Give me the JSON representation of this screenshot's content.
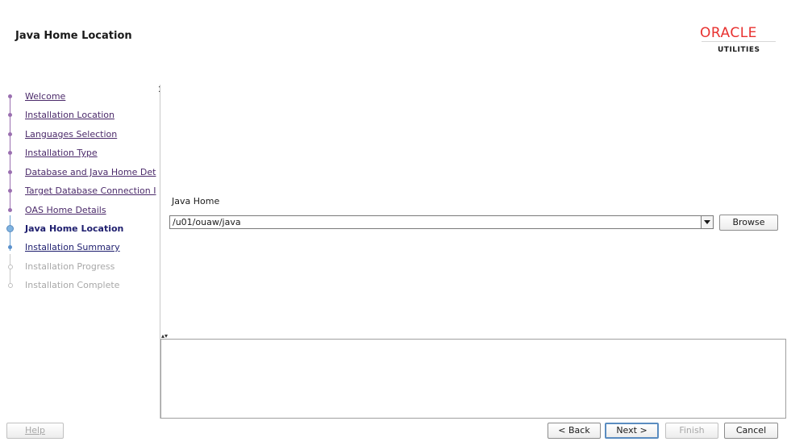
{
  "header": {
    "title": "Java Home Location",
    "logo_brand": "ORACLE",
    "logo_sub": "UTILITIES"
  },
  "steps": [
    {
      "label": "Welcome",
      "state": "done"
    },
    {
      "label": "Installation Location",
      "state": "done"
    },
    {
      "label": "Languages Selection",
      "state": "done"
    },
    {
      "label": "Installation Type",
      "state": "done"
    },
    {
      "label": "Database and Java Home Det",
      "state": "done"
    },
    {
      "label": "Target Database Connection I",
      "state": "done"
    },
    {
      "label": "OAS Home Details",
      "state": "done"
    },
    {
      "label": "Java Home Location",
      "state": "current"
    },
    {
      "label": "Installation Summary",
      "state": "next"
    },
    {
      "label": "Installation Progress",
      "state": "pending"
    },
    {
      "label": "Installation Complete",
      "state": "pending"
    }
  ],
  "main": {
    "java_home_label": "Java Home",
    "java_home_value": "/u01/ouaw/java",
    "browse_label": "Browse"
  },
  "footer": {
    "help_label": "Help",
    "back_label": "< Back",
    "next_label": "Next >",
    "finish_label": "Finish",
    "cancel_label": "Cancel"
  },
  "colors": {
    "brand": "#e8312f",
    "step_done": "#9a6fb0",
    "step_current": "#7fb3e0"
  }
}
